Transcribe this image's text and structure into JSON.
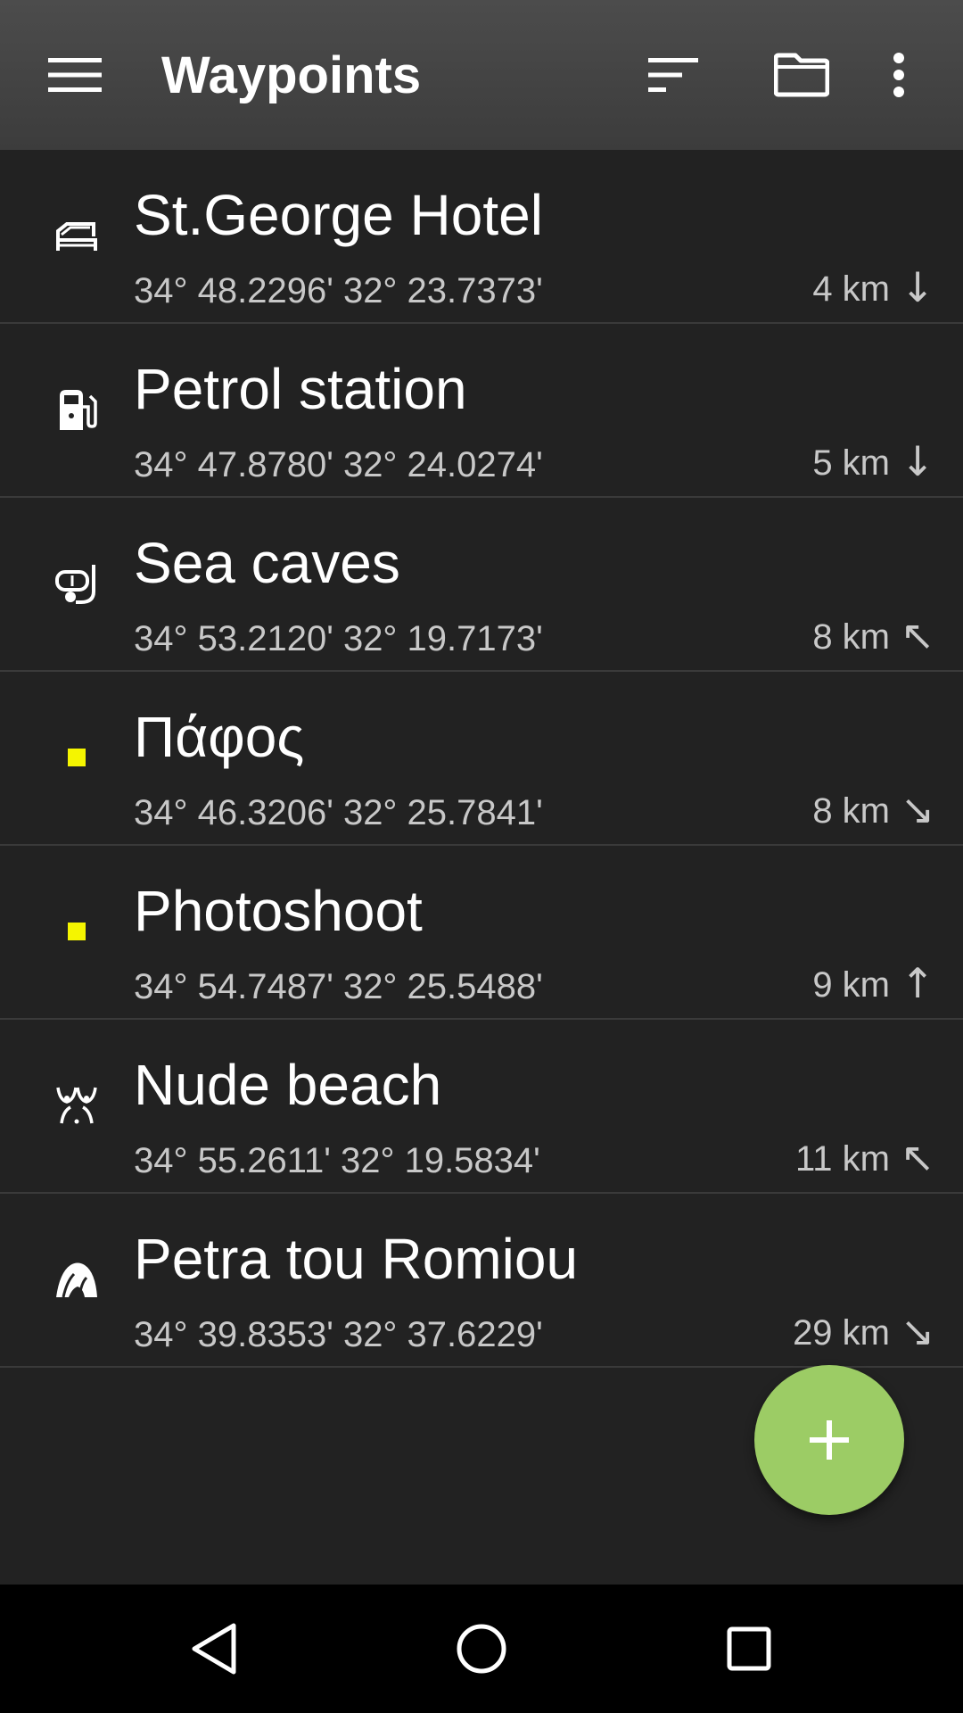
{
  "toolbar": {
    "title": "Waypoints",
    "icons": {
      "menu": "hamburger-menu-icon",
      "sort": "sort-icon",
      "folder": "folder-icon",
      "more": "more-vert-icon"
    }
  },
  "waypoints": [
    {
      "name": "St.George Hotel",
      "coords": "34° 48.2296' 32° 23.7373'",
      "distance": "4 km",
      "direction": "↓",
      "icon": "bed-icon"
    },
    {
      "name": "Petrol station",
      "coords": "34° 47.8780' 32° 24.0274'",
      "distance": "5 km",
      "direction": "↓",
      "icon": "fuel-pump-icon"
    },
    {
      "name": "Sea caves",
      "coords": "34° 53.2120' 32° 19.7173'",
      "distance": "8 km",
      "direction": "↖",
      "icon": "snorkel-mask-icon"
    },
    {
      "name": "Πάφος",
      "coords": "34° 46.3206' 32° 25.7841'",
      "distance": "8 km",
      "direction": "↘",
      "icon": "yellow-square-icon"
    },
    {
      "name": "Photoshoot",
      "coords": "34° 54.7487' 32° 25.5488'",
      "distance": "9 km",
      "direction": "↑",
      "icon": "yellow-square-icon"
    },
    {
      "name": "Nude beach",
      "coords": "34° 55.2611' 32° 19.5834'",
      "distance": "11 km",
      "direction": "↖",
      "icon": "nude-beach-icon"
    },
    {
      "name": "Petra tou Romiou",
      "coords": "34° 39.8353' 32° 37.6229'",
      "distance": "29 km",
      "direction": "↘",
      "icon": "rock-icon"
    }
  ],
  "fab": {
    "icon": "plus-icon",
    "color": "#9ccc65"
  },
  "navbar": {
    "icons": [
      "back-icon",
      "home-icon",
      "recents-icon"
    ]
  },
  "colors": {
    "background": "#222222",
    "toolbar": "#444444",
    "marker": "#f5f500"
  }
}
